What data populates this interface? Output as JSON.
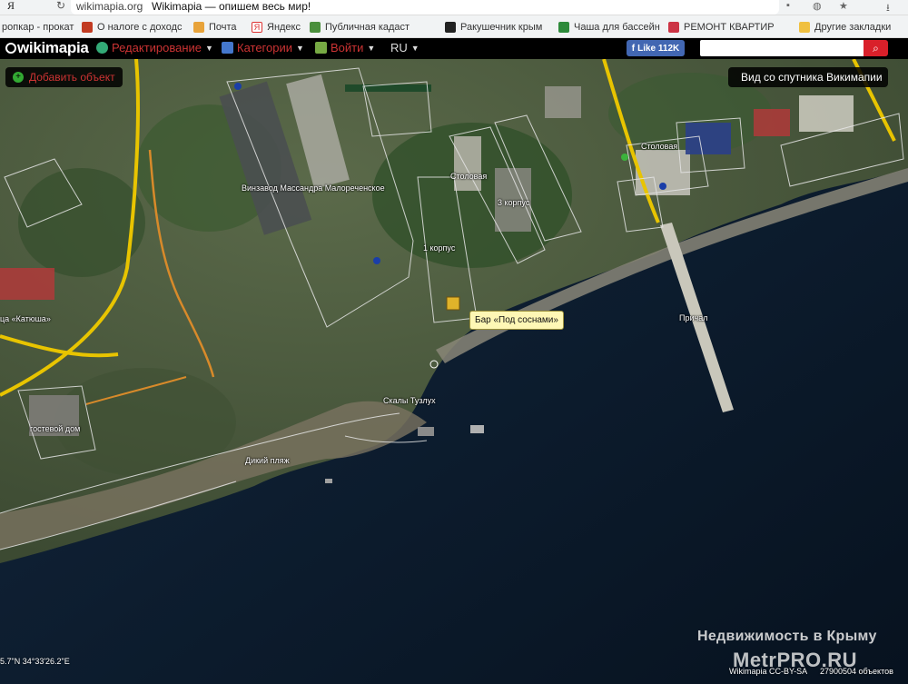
{
  "browser": {
    "logo": "Я",
    "domain": "wikimapia.org",
    "page_title": "Wikimapia — опишем весь мир!",
    "bookmarks": [
      {
        "label": "ропкар - прокат"
      },
      {
        "label": "О налоге с доходс"
      },
      {
        "label": "Почта"
      },
      {
        "label": "Яндекс"
      },
      {
        "label": "Публичная кадаст"
      },
      {
        "label": "Ракушечник крым"
      },
      {
        "label": "Чаша для бассейн"
      },
      {
        "label": "РЕМОНТ КВАРТИР"
      },
      {
        "label": "Другие закладки"
      }
    ]
  },
  "toolbar": {
    "logo": "wikimapia",
    "menu": [
      {
        "label": "Редактирование"
      },
      {
        "label": "Категории"
      },
      {
        "label": "Войти"
      },
      {
        "label": "RU"
      }
    ],
    "fb_like": "Like 112K",
    "search_placeholder": ""
  },
  "map": {
    "add_object": "Добавить объект",
    "satellite_view": "Вид со спутника Викимапии",
    "labels": {
      "winery": "Винзавод Массандра Малореченское",
      "canteen1": "Столовая",
      "canteen2": "Столовая",
      "block3": "3 корпус",
      "block1": "1 корпус",
      "pier": "Причал",
      "rocks": "Скалы Тузлух",
      "wild_beach": "Дикий пляж",
      "guest_house": "гостевой дом",
      "katyusha": "ца «Катюша»"
    },
    "tooltip": "Бар «Под соснами»",
    "coords": "5.7\"N 34°33'26.2\"E",
    "watermark_line1": "Недвижимость в Крыму",
    "watermark_line2": "MetrPRO.RU",
    "license": "Wikimapia CC-BY-SA",
    "object_count": "27900504 объектов"
  }
}
